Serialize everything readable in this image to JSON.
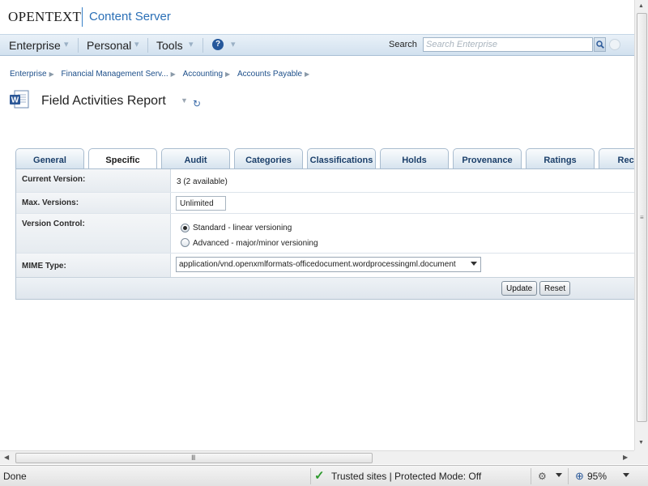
{
  "header": {
    "brand": "OPENTEXT",
    "product": "Content Server"
  },
  "nav": {
    "items": [
      "Enterprise",
      "Personal",
      "Tools"
    ],
    "help_label": "?",
    "search_label": "Search",
    "search_placeholder": "Search Enterprise"
  },
  "breadcrumb": [
    "Enterprise",
    "Financial Management Serv...",
    "Accounting",
    "Accounts Payable"
  ],
  "page": {
    "title": "Field Activities Report",
    "doc_icon": "word-document-icon",
    "refresh_icon": "↻"
  },
  "tabs": [
    {
      "label": "General",
      "active": false
    },
    {
      "label": "Specific",
      "active": true
    },
    {
      "label": "Audit",
      "active": false
    },
    {
      "label": "Categories",
      "active": false
    },
    {
      "label": "Classifications",
      "active": false
    },
    {
      "label": "Holds",
      "active": false
    },
    {
      "label": "Provenance",
      "active": false
    },
    {
      "label": "Ratings",
      "active": false
    },
    {
      "label": "Record",
      "active": false
    }
  ],
  "form": {
    "current_version_label": "Current Version:",
    "current_version_value": "3 (2 available)",
    "max_versions_label": "Max. Versions:",
    "max_versions_value": "Unlimited",
    "version_control_label": "Version Control:",
    "version_options": [
      {
        "label": "Standard - linear versioning",
        "checked": true
      },
      {
        "label": "Advanced - major/minor versioning",
        "checked": false
      }
    ],
    "mime_label": "MIME Type:",
    "mime_value": "application/vnd.openxmlformats-officedocument.wordprocessingml.document",
    "update_label": "Update",
    "reset_label": "Reset"
  },
  "scrollbar": {
    "grip": "III"
  },
  "status": {
    "text": "Done",
    "zone": "Trusted sites | Protected Mode: Off",
    "zoom": "95%"
  },
  "colors": {
    "nav_bg": "#d2e1ef",
    "link": "#1d4f8a",
    "brand_blue": "#2a6fb6",
    "trusted_check": "#2e9a2e"
  }
}
